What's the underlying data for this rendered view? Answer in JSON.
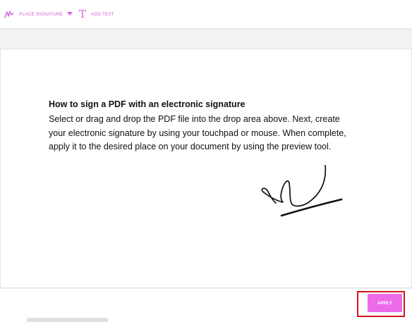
{
  "toolbar": {
    "place_signature_label": "PLACE SIGNATURE",
    "add_text_label": "ADD TEXT",
    "add_text_glyph": "T",
    "icons": [
      "signature-icon",
      "chevron-down-icon",
      "text-icon"
    ],
    "accent_color": "#d85ed6"
  },
  "document": {
    "title": "How to sign a PDF with an electronic signature",
    "body": "Select or drag and drop the PDF file into the drop area above. Next, create your electronic signature by using your touchpad or mouse. When complete, apply it to the desired place on your document by using the preview tool."
  },
  "footer": {
    "apply_label": "APPLY",
    "apply_color": "#ec6be9",
    "highlight_color": "#d9141c"
  }
}
